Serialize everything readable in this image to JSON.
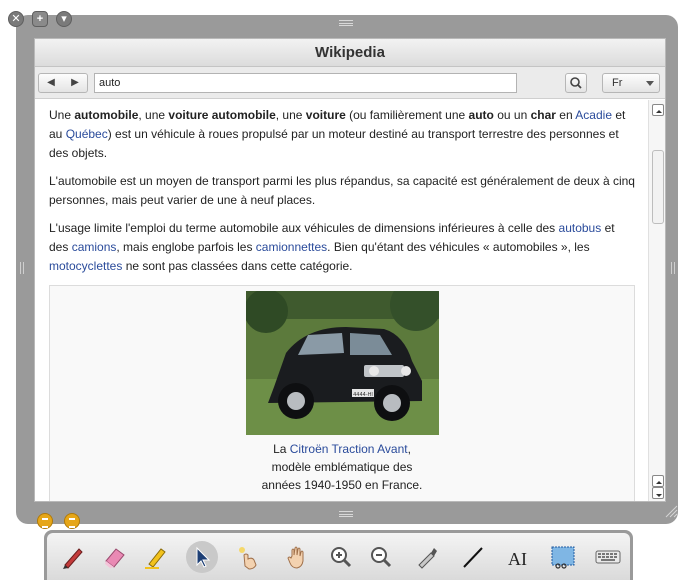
{
  "window": {
    "title": "Wikipedia",
    "url_value": "auto",
    "language": "Fr"
  },
  "article": {
    "p1": {
      "t1": "Une ",
      "b1": "automobile",
      "t2": ", une ",
      "b2": "voiture automobile",
      "t3": ", une ",
      "b3": "voiture",
      "t4": " (ou familièrement une ",
      "b4": "auto",
      "t5": " ou un ",
      "b5": "char",
      "t6": " en ",
      "link1": "Acadie",
      "t7": " et au ",
      "link2": "Québec",
      "t8": ") est un véhicule à roues propulsé par un moteur destiné au transport terrestre des personnes et des objets."
    },
    "p2": "L'automobile est un moyen de transport parmi les plus répandus, sa capacité est généralement de deux à cinq personnes, mais peut varier de une à neuf places.",
    "p3": {
      "t1": "L'usage limite l'emploi du terme automobile aux véhicules de dimensions inférieures à celle des ",
      "link1": "autobus",
      "t2": " et des ",
      "link2": "camions",
      "t3": ", mais englobe parfois les ",
      "link3": "camionnettes",
      "t4": ". Bien qu'étant des véhicules « automobiles », les ",
      "link4": "motocyclettes",
      "t5": " ne sont pas classées dans cette catégorie."
    },
    "figure": {
      "caption_pre": "La ",
      "caption_link": "Citroën Traction Avant",
      "caption_line1_end": ",",
      "caption_line2": "modèle emblématique des",
      "caption_line3": "années 1940-1950 en France.",
      "plate": "4444-HI"
    }
  },
  "toolbar": {
    "tools": [
      "pen-icon",
      "eraser-icon",
      "highlighter-icon",
      "pointer-icon",
      "laser-pointer-icon",
      "hand-icon",
      "zoom-in-icon",
      "zoom-out-icon",
      "color-picker-icon",
      "line-icon",
      "text-icon",
      "capture-icon",
      "keyboard-icon"
    ],
    "selected": "pointer-icon",
    "text_tool_label": "AI"
  },
  "colors": {
    "link": "#2a4b9b",
    "frame": "#9a9a9a",
    "mini_button": "#e6a618"
  }
}
